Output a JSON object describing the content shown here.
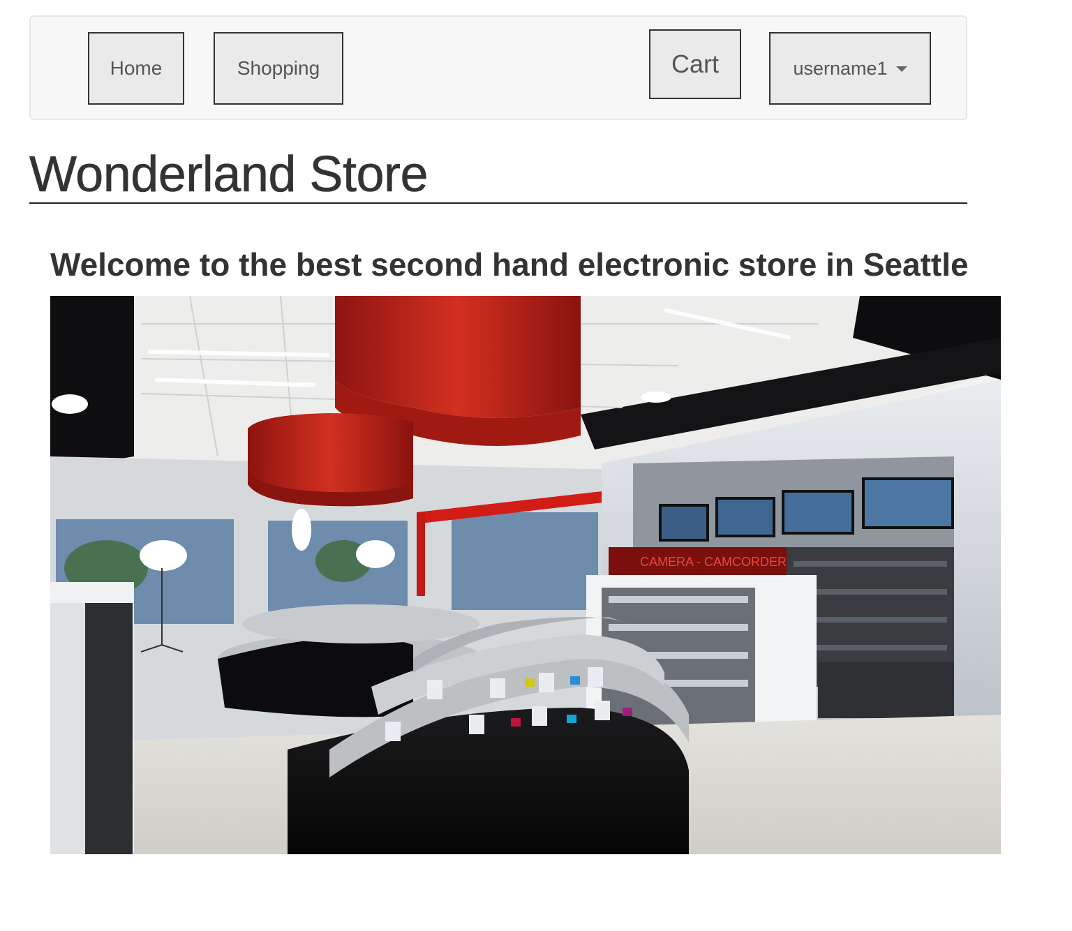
{
  "nav": {
    "home_label": "Home",
    "shopping_label": "Shopping",
    "cart_label": "Cart",
    "user_label": "username1"
  },
  "page": {
    "title": "Wonderland Store",
    "welcome": "Welcome to the best second hand electronic store in Seattle"
  },
  "icons": {
    "user_menu_caret": "chevron-down-icon"
  },
  "colors": {
    "navbar_bg": "#f7f7f7",
    "button_bg": "#eaeaea",
    "text": "#333333",
    "ceiling_ring_red": "#b8201a"
  }
}
